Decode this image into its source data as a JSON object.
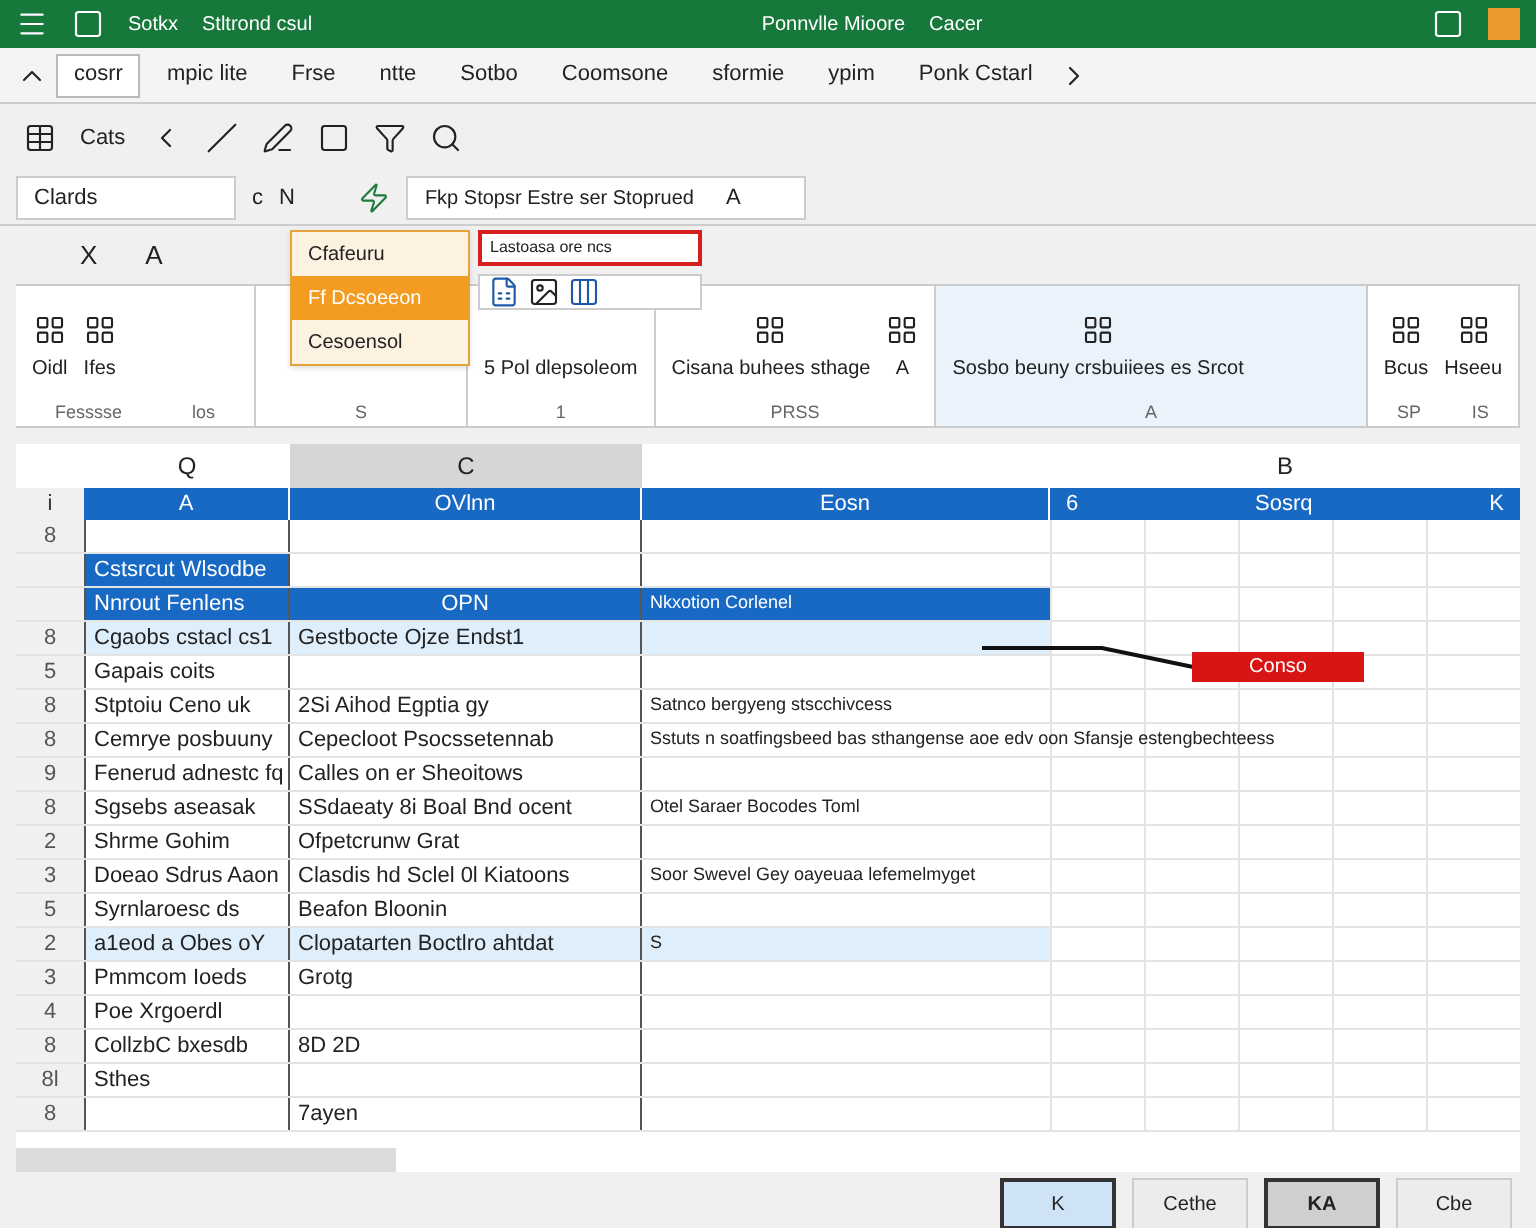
{
  "title_bar": {
    "left": [
      "Sotkx",
      "Stltrond csul"
    ],
    "center": [
      "Ponnvlle Mioore",
      "Cacer"
    ]
  },
  "ribbon_tabs": [
    {
      "label": "cosrr",
      "selected": true
    },
    {
      "label": "mpic lite",
      "selected": false
    },
    {
      "label": "Frse",
      "selected": false
    },
    {
      "label": "ntte",
      "selected": false
    },
    {
      "label": "Sotbo",
      "selected": false
    },
    {
      "label": "Coomsone",
      "selected": false
    },
    {
      "label": "sformie",
      "selected": false
    },
    {
      "label": "ypim",
      "selected": false
    },
    {
      "label": "Ponk Cstarl",
      "selected": false
    }
  ],
  "toolbar": {
    "caption": "Cats"
  },
  "formula_row": {
    "name_box": "Clards",
    "items": [
      "c",
      "N"
    ],
    "formula": "Fkp Stopsr Estre ser Stoprued",
    "formula_end": "A"
  },
  "edit_row": [
    "X",
    "A"
  ],
  "dropdown": {
    "items": [
      {
        "label": "Cfafeuru",
        "selected": false
      },
      {
        "label": "Ff Dcsoeeon",
        "selected": true
      },
      {
        "label": "Cesoensol",
        "selected": false
      }
    ],
    "search": "Lastoasa ore ncs"
  },
  "ribbon_groups": [
    {
      "items": [
        "Oidl",
        "Ifes"
      ],
      "caption": "Fesssse",
      "caption2": "los"
    },
    {
      "caption": "S"
    },
    {
      "items": [
        "5 Pol dlepsoleom"
      ],
      "caption": "1"
    },
    {
      "items": [
        "Cisana buhees sthage",
        "A"
      ],
      "caption": "PRSS"
    },
    {
      "items": [
        "Sosbo beuny crsbuiiees es Srcot"
      ],
      "caption": "A"
    },
    {
      "items": [
        "Bcus",
        "Hseeu"
      ],
      "caption": "SP",
      "caption2": "IS"
    }
  ],
  "column_letters": [
    {
      "label": "Q",
      "selected": false
    },
    {
      "label": "C",
      "selected": true
    },
    {
      "selected": false
    },
    {
      "label": "B",
      "selected": false
    }
  ],
  "header_row": {
    "num": "i",
    "cells": [
      "A",
      "OVlnn",
      "Eosn"
    ],
    "extra": [
      "6",
      "Sosrq",
      "K"
    ]
  },
  "rows": [
    {
      "num": "8",
      "kind": "plain",
      "cells": [
        "",
        "",
        ""
      ]
    },
    {
      "num": "",
      "kind": "banner",
      "cells": [
        "Cstsrcut Wlsodbe",
        "",
        ""
      ]
    },
    {
      "num": "",
      "kind": "header",
      "cells": [
        "Nnrout Fenlens",
        "OPN",
        "Nkxotion Corlenel"
      ]
    },
    {
      "num": "8",
      "kind": "tinted",
      "cells": [
        "Cgaobs cstacl cs1",
        "Gestbocte Ojze Endst1",
        ""
      ]
    },
    {
      "num": "5",
      "kind": "plain",
      "cells": [
        "Gapais coits",
        "",
        ""
      ]
    },
    {
      "num": "8",
      "kind": "plain",
      "cells": [
        "Stptoiu Ceno uk",
        "2Si Aihod Egptia gy",
        "Satnco bergyeng stscchivcess"
      ]
    },
    {
      "num": "8",
      "kind": "plain",
      "cells": [
        "Cemrye posbuuny",
        "Cepecloot Psocssetennab",
        "Sstuts n soatfingsbeed bas sthangense aoe edv oon Sfansje estengbechteess"
      ]
    },
    {
      "num": "9",
      "kind": "plain",
      "cells": [
        "Fenerud adnestc fq",
        "Calles on er Sheoitows",
        ""
      ]
    },
    {
      "num": "8",
      "kind": "plain",
      "cells": [
        "Sgsebs aseasak",
        "SSdaeaty 8i Boal Bnd ocent",
        "Otel Saraer Bocodes Toml"
      ]
    },
    {
      "num": "2",
      "kind": "plain",
      "cells": [
        "Shrme Gohim",
        "Ofpetcrunw Grat",
        ""
      ]
    },
    {
      "num": "3",
      "kind": "plain",
      "cells": [
        "Doeao Sdrus Aaon",
        "Clasdis hd Sclel 0l Kiatoons",
        "Soor Swevel Gey oayeuaa lefemelmyget"
      ]
    },
    {
      "num": "5",
      "kind": "plain",
      "cells": [
        "Syrnlaroesc ds",
        "Beafon Bloonin",
        ""
      ]
    },
    {
      "num": "2",
      "kind": "tinted",
      "cells": [
        "a1eod a Obes oY",
        "Clopatarten Boctlro ahtdat",
        "S"
      ]
    },
    {
      "num": "3",
      "kind": "plain",
      "cells": [
        "Pmmcom Ioeds",
        "Grotg",
        ""
      ]
    },
    {
      "num": "4",
      "kind": "plain",
      "cells": [
        "Poe Xrgoerdl",
        "",
        ""
      ]
    },
    {
      "num": "8",
      "kind": "plain",
      "cells": [
        "CollzbC bxesdb",
        "8D 2D",
        ""
      ]
    },
    {
      "num": "8l",
      "kind": "plain",
      "cells": [
        "Sthes",
        "",
        ""
      ]
    },
    {
      "num": "8",
      "kind": "plain",
      "cells": [
        "",
        "7ayen",
        ""
      ]
    }
  ],
  "callout": {
    "label": "Conso"
  },
  "status_buttons": [
    {
      "label": "K",
      "kind": "active"
    },
    {
      "label": "Cethe",
      "kind": "plain"
    },
    {
      "label": "KA",
      "kind": "pressed"
    },
    {
      "label": "Cbe",
      "kind": "plain"
    }
  ]
}
